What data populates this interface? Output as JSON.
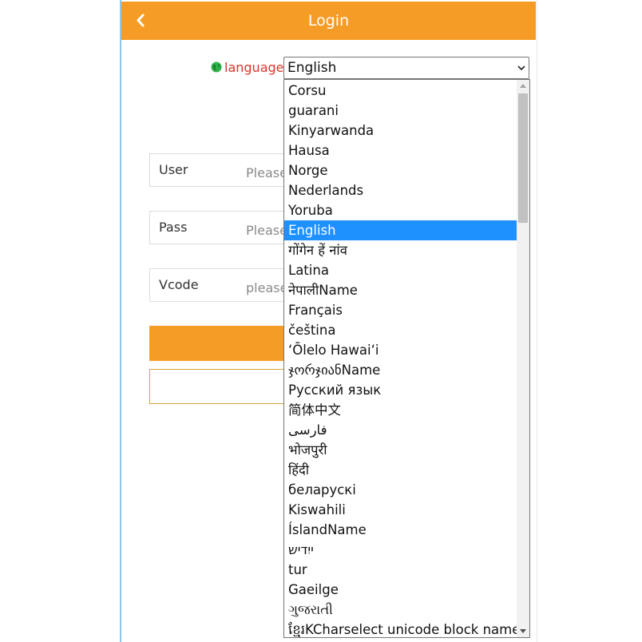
{
  "header": {
    "title": "Login",
    "color": "#f59c26"
  },
  "language": {
    "label": "language",
    "label_color": "#e0322b",
    "selected": "English"
  },
  "form": {
    "user": {
      "label": "User",
      "placeholder": "Please"
    },
    "pass": {
      "label": "Pass",
      "placeholder": "Please"
    },
    "vcode": {
      "label": "Vcode",
      "placeholder": "please"
    }
  },
  "dropdown": {
    "highlight_color": "#1e90ff",
    "options": [
      "Corsu",
      "guarani",
      "Kinyarwanda",
      "Hausa",
      "Norge",
      "Nederlands",
      "Yoruba",
      "English",
      "गोंगेन हें नांव",
      "Latina",
      "नेपालीName",
      "Français",
      "čeština",
      "ʻŌlelo Hawaiʻi",
      "ჯორჯიანName",
      "Русский язык",
      "简体中文",
      "فارسی",
      "भोजपुरी",
      "हिंदी",
      "беларускі",
      "Kiswahili",
      "ÍslandName",
      "ייִדיש",
      "tur",
      "Gaeilge",
      "ગુજરાતી",
      "ខ្មែរKCharselect unicode block name"
    ]
  }
}
